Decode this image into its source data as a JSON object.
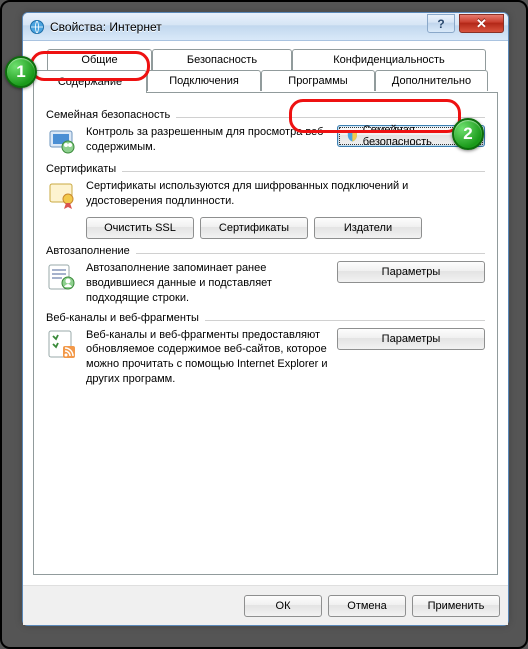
{
  "window": {
    "title": "Свойства: Интернет"
  },
  "tabs": {
    "row0": [
      {
        "label": "Общие"
      },
      {
        "label": "Безопасность"
      },
      {
        "label": "Конфиденциальность"
      }
    ],
    "row1": [
      {
        "label": "Содержание",
        "active": true
      },
      {
        "label": "Подключения"
      },
      {
        "label": "Программы"
      },
      {
        "label": "Дополнительно"
      }
    ]
  },
  "groups": {
    "family": {
      "title": "Семейная безопасность",
      "desc": "Контроль за разрешенным для просмотра веб-содержимым.",
      "button": "Семейная безопасность"
    },
    "certs": {
      "title": "Сертификаты",
      "desc": "Сертификаты используются для шифрованных подключений и удостоверения подлинности.",
      "clear_ssl": "Очистить SSL",
      "certs_btn": "Сертификаты",
      "publishers": "Издатели"
    },
    "autocomplete": {
      "title": "Автозаполнение",
      "desc": "Автозаполнение запоминает ранее вводившиеся данные и подставляет подходящие строки.",
      "params": "Параметры"
    },
    "feeds": {
      "title": "Веб-каналы и веб-фрагменты",
      "desc": "Веб-каналы и веб-фрагменты предоставляют обновляемое содержимое веб-сайтов, которое можно прочитать с помощью Internet Explorer и других программ.",
      "params": "Параметры"
    }
  },
  "footer": {
    "ok": "ОК",
    "cancel": "Отмена",
    "apply": "Применить"
  },
  "annotations": {
    "b1": "1",
    "b2": "2"
  }
}
